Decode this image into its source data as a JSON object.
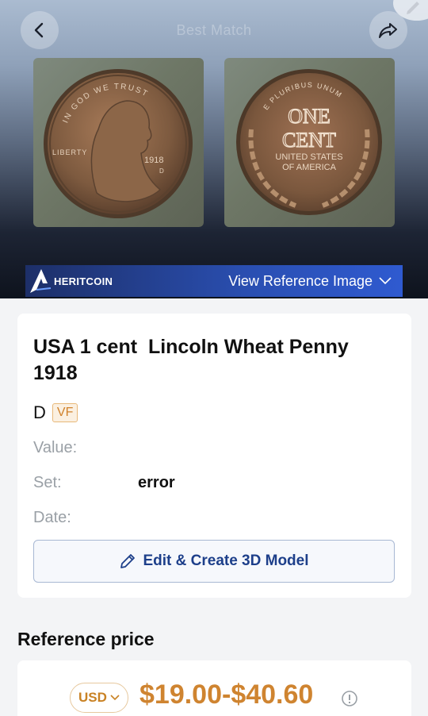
{
  "header": {
    "title": "Best Match",
    "back_icon": "chevron-left-icon",
    "share_icon": "share-arrow-icon",
    "edit_icon": "pencil-icon"
  },
  "images": {
    "obverse": {
      "motto": "IN GOD WE TRUST",
      "liberty": "LIBERTY",
      "year": "1918",
      "mint": "D"
    },
    "reverse": {
      "top": "E PLURIBUS UNUM",
      "denomination_line1": "ONE",
      "denomination_line2": "CENT",
      "country_line1": "UNITED STATES",
      "country_line2": "OF AMERICA"
    }
  },
  "banner": {
    "brand": "HERITCOIN",
    "reference_link": "View Reference Image",
    "reference_icon": "chevron-down-icon"
  },
  "coin": {
    "title": "USA 1 cent  Lincoln Wheat Penny\n1918",
    "mint_mark": "D",
    "grade": "VF",
    "fields": [
      {
        "label": "Value:",
        "value": ""
      },
      {
        "label": "Set:",
        "value": "error"
      },
      {
        "label": "Date:",
        "value": ""
      }
    ],
    "edit_button": "Edit & Create 3D Model"
  },
  "reference_price": {
    "section_title": "Reference price",
    "currency": "USD",
    "range": "$19.00-$40.60"
  },
  "colors": {
    "accent_orange": "#cf8430",
    "accent_blue": "#1d3f8a",
    "banner_blue": "#2a4fb2"
  }
}
